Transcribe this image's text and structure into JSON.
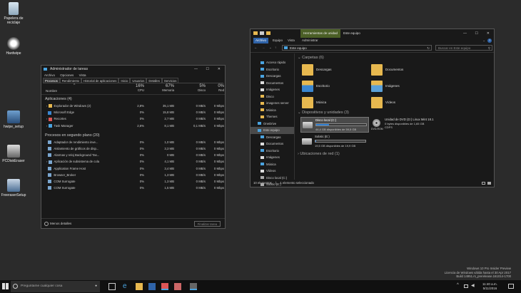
{
  "desktop_icons": [
    {
      "label": "Papelera de reciclaje"
    },
    {
      "label": "Hardwipe"
    },
    {
      "label": "hwipe_setup"
    },
    {
      "label": "PCDiskEraser"
    },
    {
      "label": "FreeraserSetup"
    }
  ],
  "taskmgr": {
    "title": "Administrador de tareas",
    "menu": [
      "Archivo",
      "Opciones",
      "Vista"
    ],
    "tabs": [
      "Procesos",
      "Rendimiento",
      "Historial de aplicaciones",
      "Inicio",
      "Usuarios",
      "Detalles",
      "Servicios"
    ],
    "header": {
      "name": "Nombre",
      "cpu_pct": "16%",
      "cpu": "CPU",
      "mem_pct": "67%",
      "mem": "Memoria",
      "disk_pct": "5%",
      "disk": "Disco",
      "net_pct": "0%",
      "net": "Red"
    },
    "apps_label": "Aplicaciones (4)",
    "apps": [
      {
        "name": "Explorador de Windows (2)",
        "cpu": "2,8%",
        "mem": "35,1 MB",
        "disk": "0 MB/s",
        "net": "0 Mbps"
      },
      {
        "name": "Microsoft Edge",
        "cpu": "0%",
        "mem": "15,8 MB",
        "disk": "0 MB/s",
        "net": "0 Mbps"
      },
      {
        "name": "Recortes",
        "cpu": "0%",
        "mem": "2,7 MB",
        "disk": "0 MB/s",
        "net": "0 Mbps"
      },
      {
        "name": "Task Manager",
        "cpu": "2,6%",
        "mem": "8,1 MB",
        "disk": "0,1 MB/s",
        "net": "0 Mbps"
      }
    ],
    "bg_label": "Procesos en segundo plano (20)",
    "bg": [
      {
        "name": "Adaptador de rendimiento inve...",
        "cpu": "0%",
        "mem": "1,0 MB",
        "disk": "0 MB/s",
        "net": "0 Mbps"
      },
      {
        "name": "Aislamiento de gráficos de disp...",
        "cpu": "0%",
        "mem": "3,3 MB",
        "disk": "0 MB/s",
        "net": "0 Mbps"
      },
      {
        "name": "Alarmas y reloj Background Tas...",
        "cpu": "0%",
        "mem": "0 MB",
        "disk": "0 MB/s",
        "net": "0 Mbps"
      },
      {
        "name": "Aplicación de subsistema de cola",
        "cpu": "0%",
        "mem": "4,1 MB",
        "disk": "0 MB/s",
        "net": "0 Mbps"
      },
      {
        "name": "Application Frame Host",
        "cpu": "0%",
        "mem": "3,4 MB",
        "disk": "0 MB/s",
        "net": "0 Mbps"
      },
      {
        "name": "Browser_Broker",
        "cpu": "0%",
        "mem": "1,3 MB",
        "disk": "0 MB/s",
        "net": "0 Mbps"
      },
      {
        "name": "COM Surrogate",
        "cpu": "0%",
        "mem": "1,3 MB",
        "disk": "0 MB/s",
        "net": "0 Mbps"
      },
      {
        "name": "COM Surrogate",
        "cpu": "0%",
        "mem": "1,5 MB",
        "disk": "0 MB/s",
        "net": "0 Mbps"
      }
    ],
    "less_details": "Menos detalles",
    "end_task": "Finalizar tarea"
  },
  "explorer": {
    "context_tab": "Herramientas de unidad",
    "title": "Este equipo",
    "ribbon": [
      "Archivo",
      "Equipo",
      "Vista",
      "Administrar"
    ],
    "address": "Este equipo",
    "search_placeholder": "Buscar en Este equipo",
    "nav": [
      {
        "label": "Acceso rápido",
        "color": "#4aa3df"
      },
      {
        "label": "Escritorio",
        "color": "#4aa3df"
      },
      {
        "label": "Descargas",
        "color": "#4aa3df"
      },
      {
        "label": "Documentos",
        "color": "#ddd"
      },
      {
        "label": "Imágenes",
        "color": "#ddd"
      },
      {
        "label": "Disco",
        "color": "#e7b84f"
      },
      {
        "label": "imagenes server",
        "color": "#e7b84f"
      },
      {
        "label": "Música",
        "color": "#e7b84f"
      },
      {
        "label": "Themes",
        "color": "#e7b84f"
      },
      {
        "label": "OneDrive",
        "color": "#4aa3df"
      },
      {
        "label": "Este equipo",
        "color": "#4aa3df"
      },
      {
        "label": "Descargas",
        "color": "#4aa3df"
      },
      {
        "label": "Documentos",
        "color": "#ddd"
      },
      {
        "label": "Escritorio",
        "color": "#4aa3df"
      },
      {
        "label": "Imágenes",
        "color": "#ddd"
      },
      {
        "label": "Música",
        "color": "#4aa3df"
      },
      {
        "label": "Vídeos",
        "color": "#ddd"
      },
      {
        "label": "Disco local (C:)",
        "color": "#aaa"
      },
      {
        "label": "Solxtic (E:)",
        "color": "#aaa"
      }
    ],
    "folders_label": "Carpetas (6)",
    "folders": [
      "Descargas",
      "Documentos",
      "Escritorio",
      "Imágenes",
      "Música",
      "Vídeos"
    ],
    "devices_label": "Dispositivos y unidades (3)",
    "drives": [
      {
        "name": "Disco local (C:)",
        "free": "44,4 GB disponibles de 59,5 GB",
        "fill": 0.25
      },
      {
        "name": "Unidad de DVD (D:) Linux Mint 18.1",
        "free": "0 bytes disponibles de 1,65 GB",
        "fs": "CDFS",
        "icon": "DVD-ROM"
      },
      {
        "name": "Solxtic (E:)",
        "free": "19,5 GB disponibles de 19,9 GB",
        "fill": 0.02
      }
    ],
    "network_label": "Ubicaciones de red (1)",
    "status_items": "10 elementos",
    "status_sel": "1 elemento seleccionado"
  },
  "taskbar": {
    "search_placeholder": "Preguntame cualquier cosa",
    "watermark": [
      "Windows 10 Pro Insider Preview",
      "Licencia de Windows válida hasta el 30 Apr 2017",
      "Build 14951.rs_prerelease.161014-1700"
    ],
    "time": "11:40 a.m.",
    "date": "5/11/2016"
  }
}
